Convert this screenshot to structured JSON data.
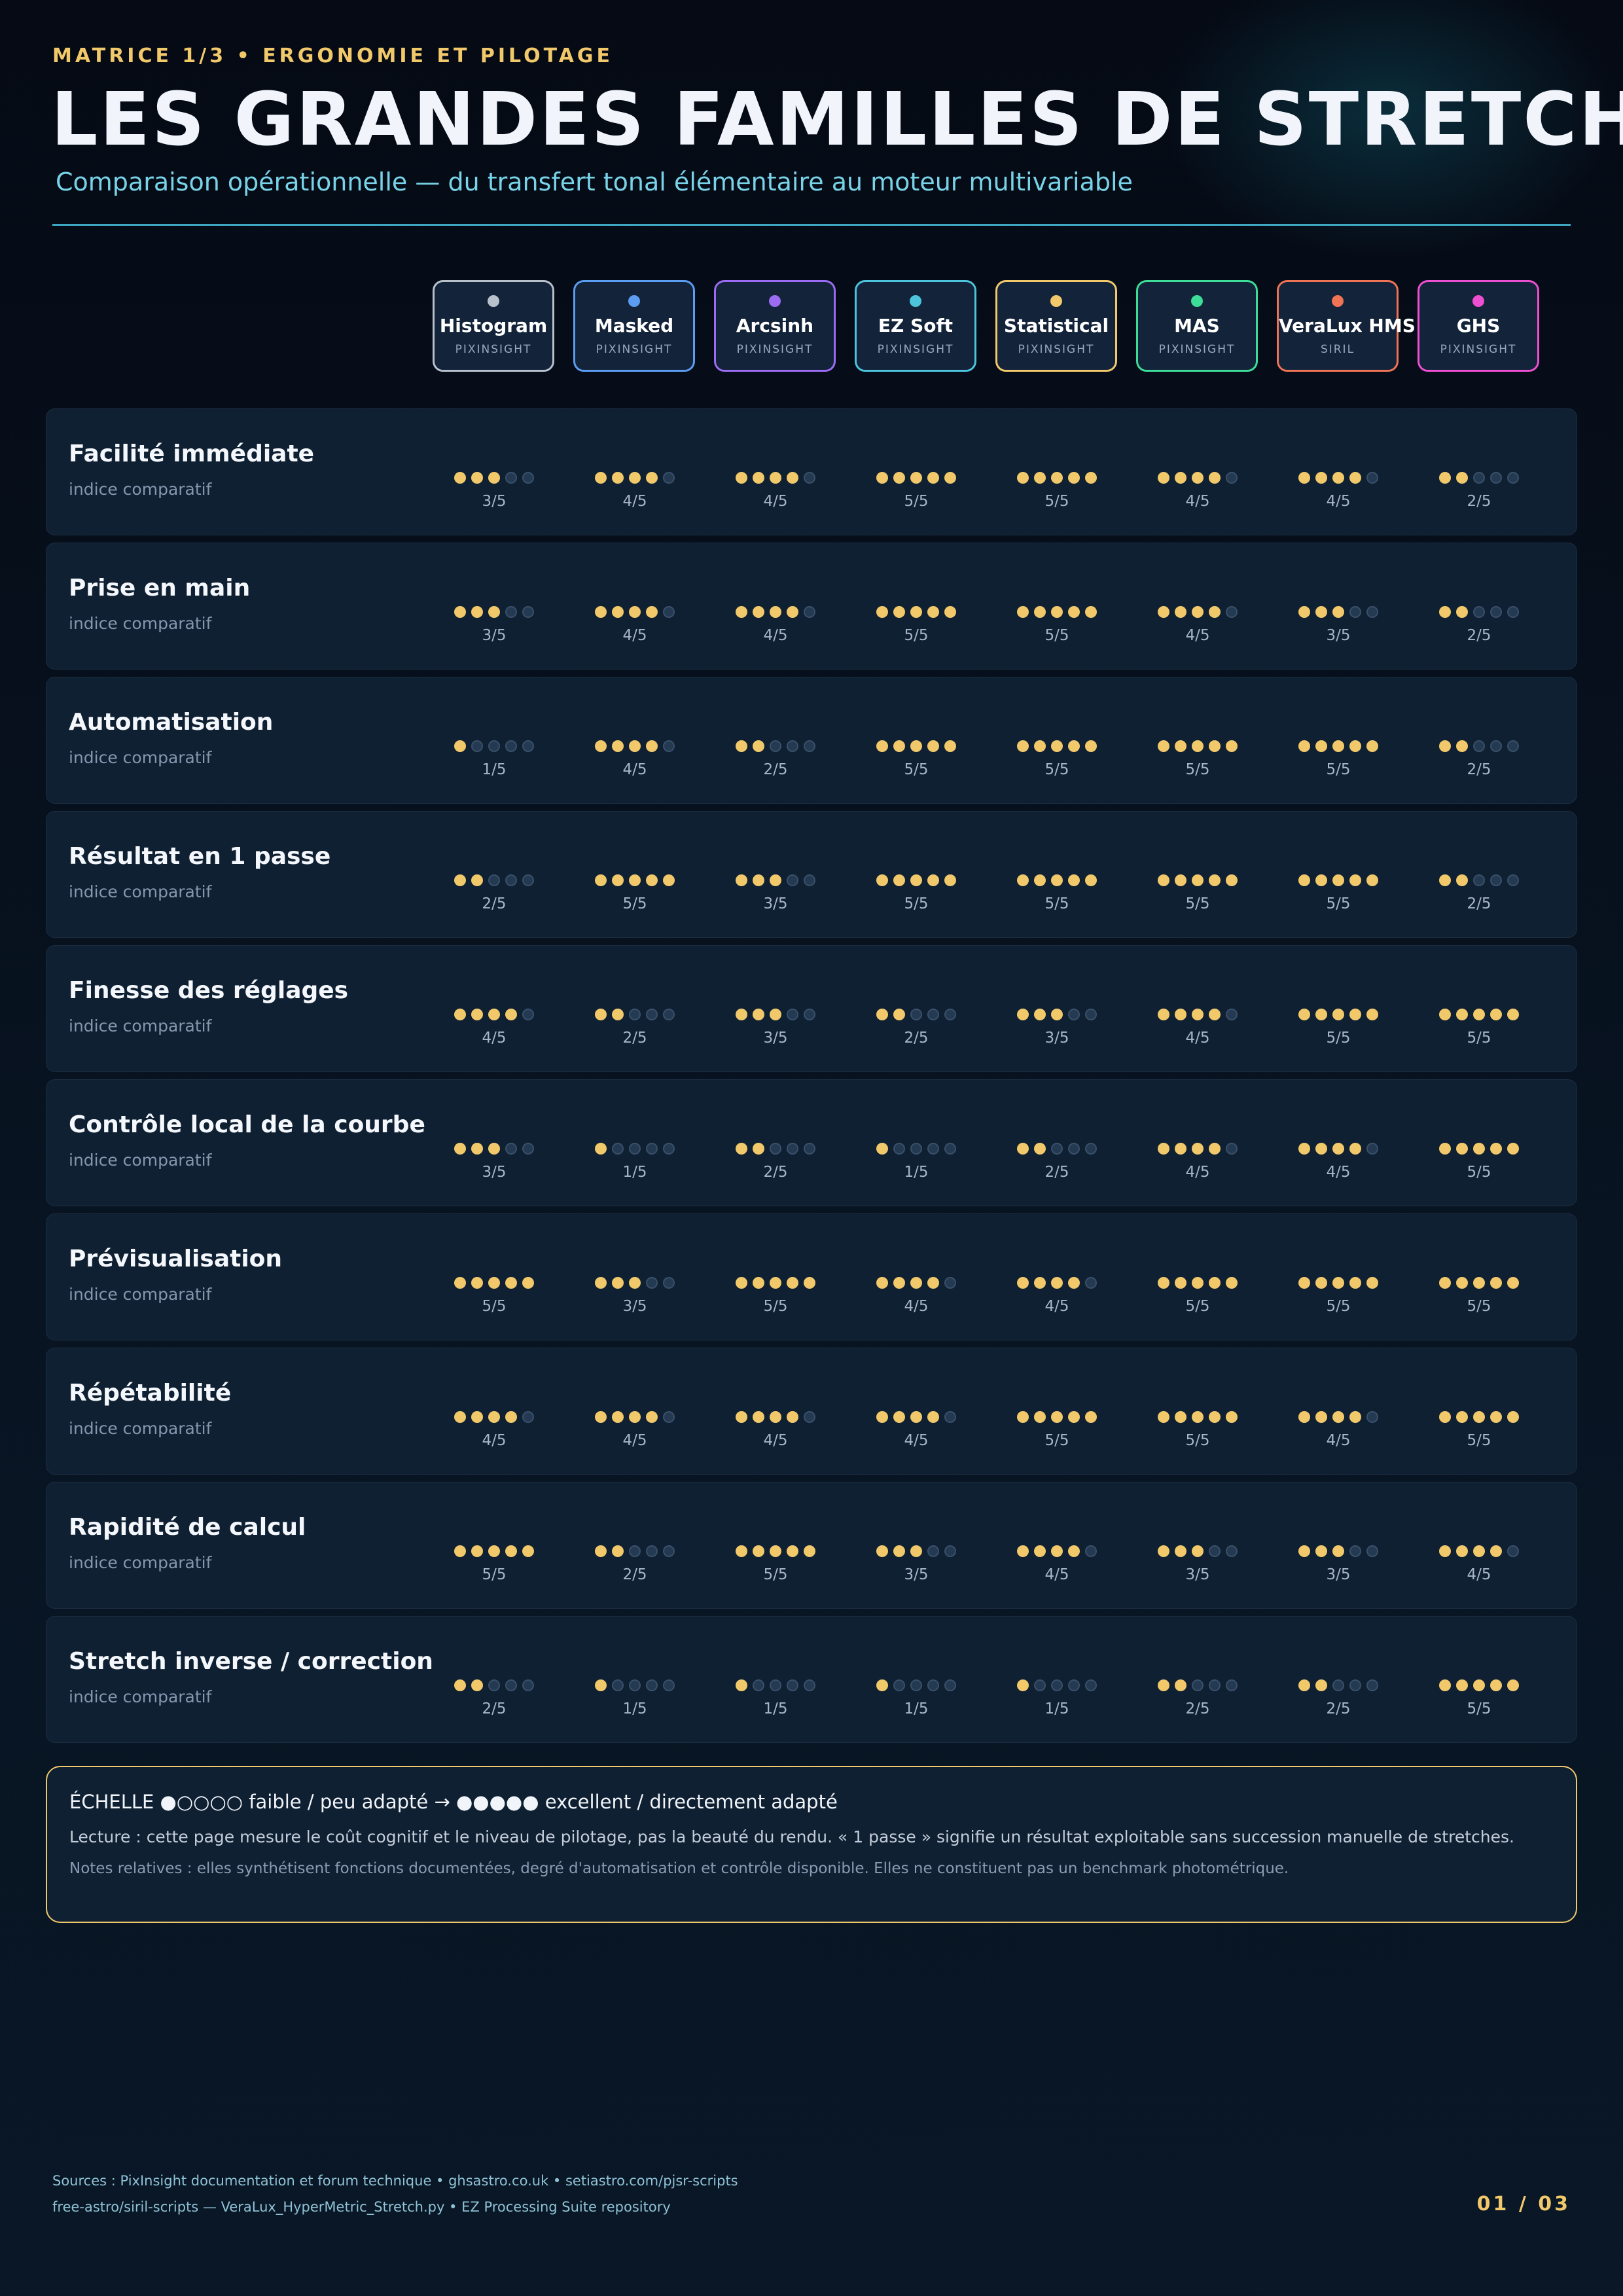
{
  "header": {
    "kicker": "MATRICE 1/3 • ERGONOMIE ET PILOTAGE",
    "title": "LES GRANDES FAMILLES DE STRETCH",
    "subtitle": "Comparaison opérationnelle — du transfert tonal élémentaire au moteur multivariable"
  },
  "columns": [
    {
      "name": "Histogram",
      "tool": "PIXINSIGHT",
      "color": "#b8c0cc"
    },
    {
      "name": "Masked",
      "tool": "PIXINSIGHT",
      "color": "#5b9df0"
    },
    {
      "name": "Arcsinh",
      "tool": "PIXINSIGHT",
      "color": "#9b6cf2"
    },
    {
      "name": "EZ Soft",
      "tool": "PIXINSIGHT",
      "color": "#4cc4dc"
    },
    {
      "name": "Statistical",
      "tool": "PIXINSIGHT",
      "color": "#f2c96a"
    },
    {
      "name": "MAS",
      "tool": "PIXINSIGHT",
      "color": "#3ddc97"
    },
    {
      "name": "VeraLux HMS",
      "tool": "SIRIL",
      "color": "#ef7355"
    },
    {
      "name": "GHS",
      "tool": "PIXINSIGHT",
      "color": "#ec4fcf"
    }
  ],
  "rows": [
    {
      "label": "Facilité immédiate",
      "sub": "indice comparatif",
      "scores": [
        3,
        4,
        4,
        5,
        5,
        4,
        4,
        2
      ],
      "texts": [
        "3/5",
        "4/5",
        "4/5",
        "5/5",
        "5/5",
        "4/5",
        "4/5",
        "2/5"
      ]
    },
    {
      "label": "Prise en main",
      "sub": "indice comparatif",
      "scores": [
        3,
        4,
        4,
        5,
        5,
        4,
        3,
        2
      ],
      "texts": [
        "3/5",
        "4/5",
        "4/5",
        "5/5",
        "5/5",
        "4/5",
        "3/5",
        "2/5"
      ]
    },
    {
      "label": "Automatisation",
      "sub": "indice comparatif",
      "scores": [
        1,
        4,
        2,
        5,
        5,
        5,
        5,
        2
      ],
      "texts": [
        "1/5",
        "4/5",
        "2/5",
        "5/5",
        "5/5",
        "5/5",
        "5/5",
        "2/5"
      ]
    },
    {
      "label": "Résultat en 1 passe",
      "sub": "indice comparatif",
      "scores": [
        2,
        5,
        3,
        5,
        5,
        5,
        5,
        2
      ],
      "texts": [
        "2/5",
        "5/5",
        "3/5",
        "5/5",
        "5/5",
        "5/5",
        "5/5",
        "2/5"
      ]
    },
    {
      "label": "Finesse des réglages",
      "sub": "indice comparatif",
      "scores": [
        4,
        2,
        3,
        2,
        3,
        4,
        5,
        5
      ],
      "texts": [
        "4/5",
        "2/5",
        "3/5",
        "2/5",
        "3/5",
        "4/5",
        "5/5",
        "5/5"
      ]
    },
    {
      "label": "Contrôle local de la courbe",
      "sub": "indice comparatif",
      "scores": [
        3,
        1,
        2,
        1,
        2,
        4,
        4,
        5
      ],
      "texts": [
        "3/5",
        "1/5",
        "2/5",
        "1/5",
        "2/5",
        "4/5",
        "4/5",
        "5/5"
      ]
    },
    {
      "label": "Prévisualisation",
      "sub": "indice comparatif",
      "scores": [
        5,
        3,
        5,
        4,
        4,
        5,
        5,
        5
      ],
      "texts": [
        "5/5",
        "3/5",
        "5/5",
        "4/5",
        "4/5",
        "5/5",
        "5/5",
        "5/5"
      ]
    },
    {
      "label": "Répétabilité",
      "sub": "indice comparatif",
      "scores": [
        4,
        4,
        4,
        4,
        5,
        5,
        4,
        5
      ],
      "texts": [
        "4/5",
        "4/5",
        "4/5",
        "4/5",
        "5/5",
        "5/5",
        "4/5",
        "5/5"
      ]
    },
    {
      "label": "Rapidité de calcul",
      "sub": "indice comparatif",
      "scores": [
        5,
        2,
        5,
        3,
        4,
        3,
        3,
        4
      ],
      "texts": [
        "5/5",
        "2/5",
        "5/5",
        "3/5",
        "4/5",
        "3/5",
        "3/5",
        "4/5"
      ]
    },
    {
      "label": "Stretch inverse / correction",
      "sub": "indice comparatif",
      "scores": [
        2,
        1,
        1,
        1,
        1,
        2,
        2,
        5
      ],
      "texts": [
        "2/5",
        "1/5",
        "1/5",
        "1/5",
        "1/5",
        "2/5",
        "2/5",
        "5/5"
      ]
    }
  ],
  "legend": {
    "scale": "ÉCHELLE ●○○○○ faible / peu adapté → ●●●●● excellent / directement adapté",
    "reading": "Lecture : cette page mesure le coût cognitif et le niveau de pilotage, pas la beauté du rendu. « 1 passe » signifie un résultat exploitable sans succession manuelle de stretches.",
    "notes": "Notes relatives : elles synthétisent fonctions documentées, degré d'automatisation et contrôle disponible. Elles ne constituent pas un benchmark photométrique."
  },
  "footer": {
    "sources_line1": "Sources : PixInsight documentation et forum technique • ghsastro.co.uk • setiastro.com/pjsr-scripts",
    "sources_line2": "free-astro/siril-scripts — VeraLux_HyperMetric_Stretch.py • EZ Processing Suite repository",
    "page": "01 / 03"
  }
}
